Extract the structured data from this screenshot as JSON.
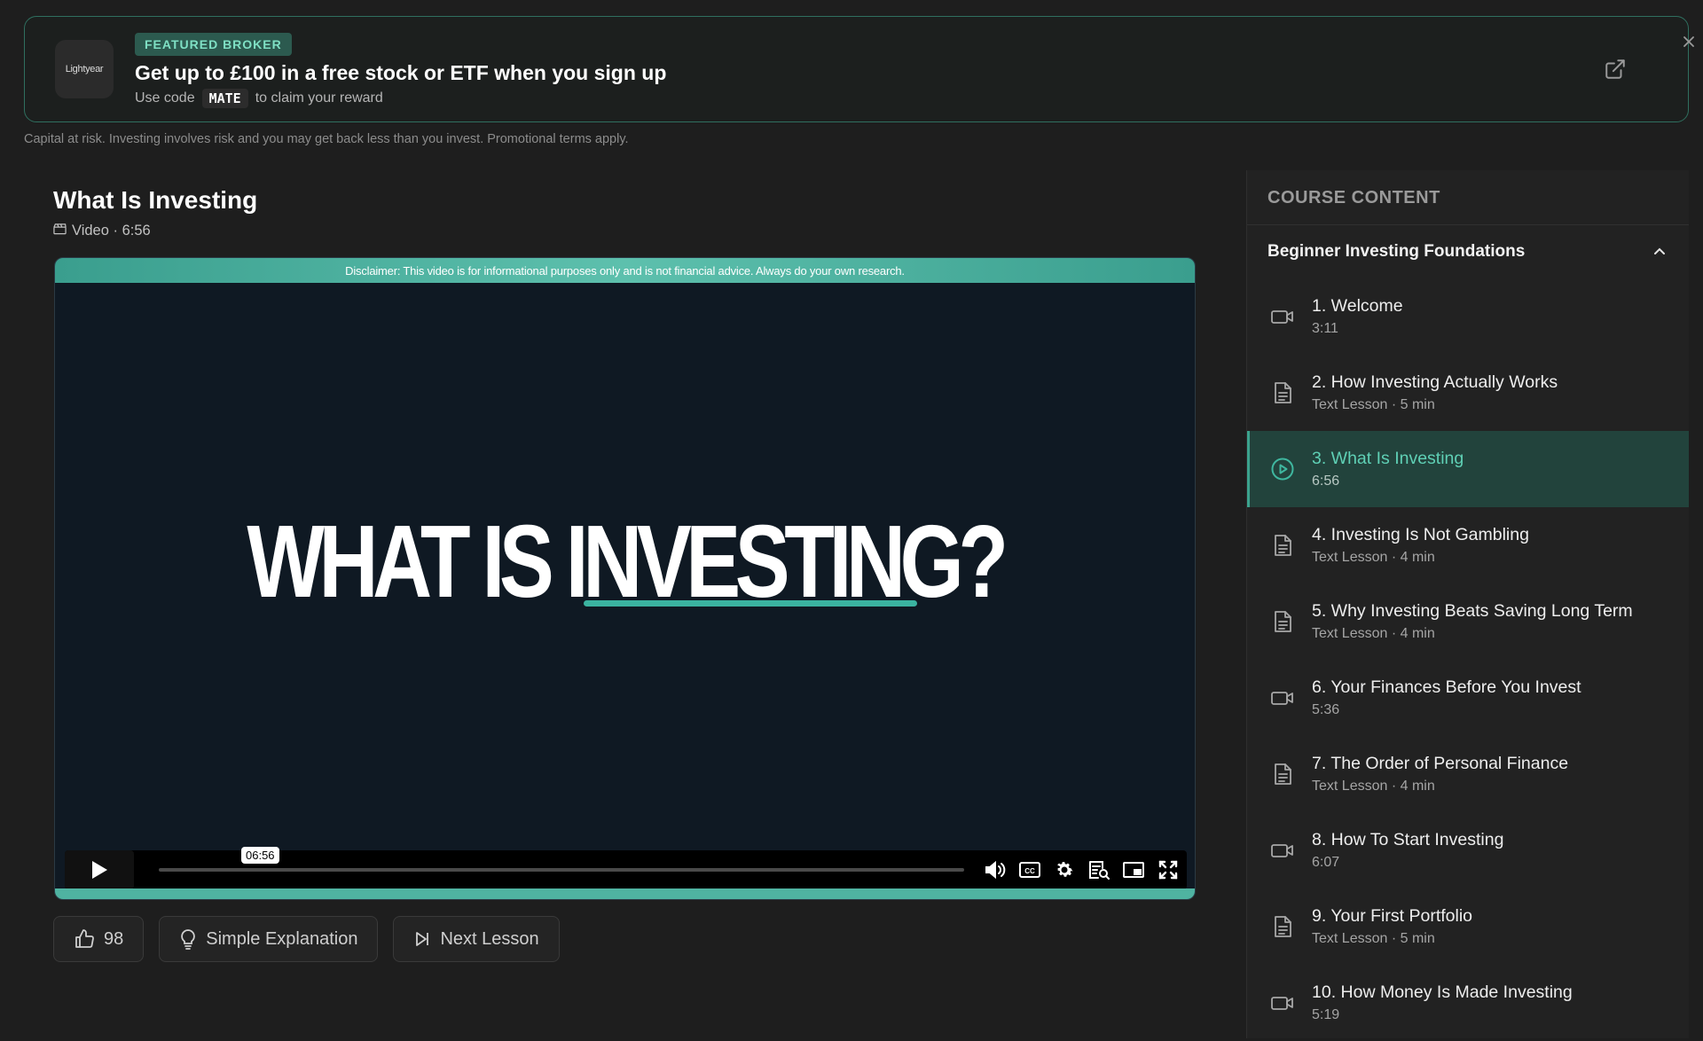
{
  "promo": {
    "logo_text": "Lightyear",
    "badge": "FEATURED BROKER",
    "title": "Get up to £100 in a free stock or ETF when you sign up",
    "sub_prefix": "Use code",
    "code": "MATE",
    "sub_suffix": "to claim your reward"
  },
  "risk_notice": "Capital at risk. Investing involves risk and you may get back less than you invest. Promotional terms apply.",
  "lesson": {
    "title": "What Is Investing",
    "meta": "Video · 6:56"
  },
  "video": {
    "disclaimer": "Disclaimer: This video is for informational purposes only and is not financial advice. Always do your own research.",
    "headline": "WHAT IS INVESTING?",
    "time_tooltip": "06:56",
    "progress": 0
  },
  "actions": {
    "likes": "98",
    "simple_label": "Simple Explanation",
    "next_label": "Next Lesson"
  },
  "sidebar": {
    "header": "COURSE CONTENT",
    "section_title": "Beginner Investing Foundations",
    "items": [
      {
        "title": "1. Welcome",
        "sub": "3:11",
        "icon": "video-icon"
      },
      {
        "title": "2. How Investing Actually Works",
        "sub": "Text Lesson · 5 min",
        "icon": "document-icon"
      },
      {
        "title": "3. What Is Investing",
        "sub": "6:56",
        "icon": "play-circle-icon",
        "active": true
      },
      {
        "title": "4. Investing Is Not Gambling",
        "sub": "Text Lesson · 4 min",
        "icon": "document-icon"
      },
      {
        "title": "5. Why Investing Beats Saving Long Term",
        "sub": "Text Lesson · 4 min",
        "icon": "document-icon"
      },
      {
        "title": "6. Your Finances Before You Invest",
        "sub": "5:36",
        "icon": "video-icon"
      },
      {
        "title": "7. The Order of Personal Finance",
        "sub": "Text Lesson · 4 min",
        "icon": "document-icon"
      },
      {
        "title": "8. How To Start Investing",
        "sub": "6:07",
        "icon": "video-icon"
      },
      {
        "title": "9. Your First Portfolio",
        "sub": "Text Lesson · 5 min",
        "icon": "document-icon"
      },
      {
        "title": "10. How Money Is Made Investing",
        "sub": "5:19",
        "icon": "video-icon"
      }
    ]
  },
  "colors": {
    "accent": "#3ba38e",
    "background": "#1e1e1e",
    "sidebar": "#222222",
    "active_item": "#22433c"
  }
}
